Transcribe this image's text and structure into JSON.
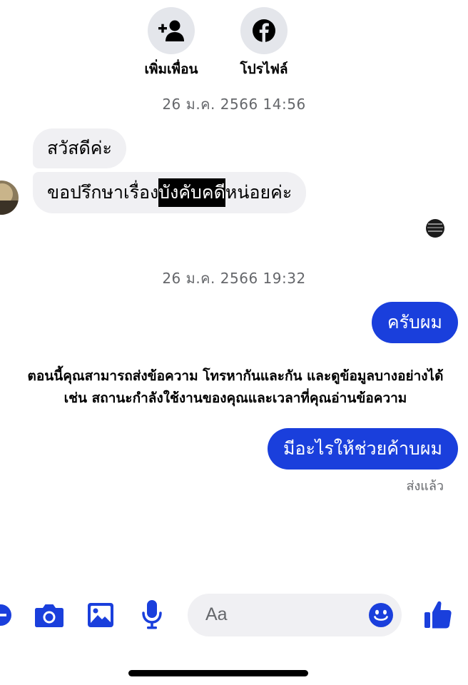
{
  "profile_actions": {
    "add_friend_label": "เพิ่มเพื่อน",
    "profile_label": "โปรไฟล์"
  },
  "conversation": {
    "timestamp_1": "26 ม.ค. 2566 14:56",
    "incoming_1": "สวัสดีค่ะ",
    "incoming_2_before": "ขอปรึกษาเรื่อง",
    "incoming_2_highlight": "บังคับคดี",
    "incoming_2_after": "หน่อยค่ะ",
    "timestamp_2": "26 ม.ค. 2566 19:32",
    "outgoing_1": "ครับผม",
    "notice_line_1": "ตอนนี้คุณสามารถส่งข้อความ โทรหากันและกัน และดูข้อมูลบางอย่างได้",
    "notice_line_2": "เช่น สถานะกำลังใช้งานของคุณและเวลาที่คุณอ่านข้อความ",
    "outgoing_2": "มีอะไรให้ช่วยค้าบผม",
    "sent_status": "ส่งแล้ว"
  },
  "composer": {
    "placeholder": "Aa"
  },
  "colors": {
    "accent": "#1a3fdc",
    "incoming_bubble": "#f0f0f3",
    "muted_text": "#65676b"
  },
  "icons": [
    "add-friend-icon",
    "facebook-icon",
    "plus-icon",
    "camera-icon",
    "gallery-icon",
    "microphone-icon",
    "emoji-icon",
    "thumbs-up-icon"
  ]
}
